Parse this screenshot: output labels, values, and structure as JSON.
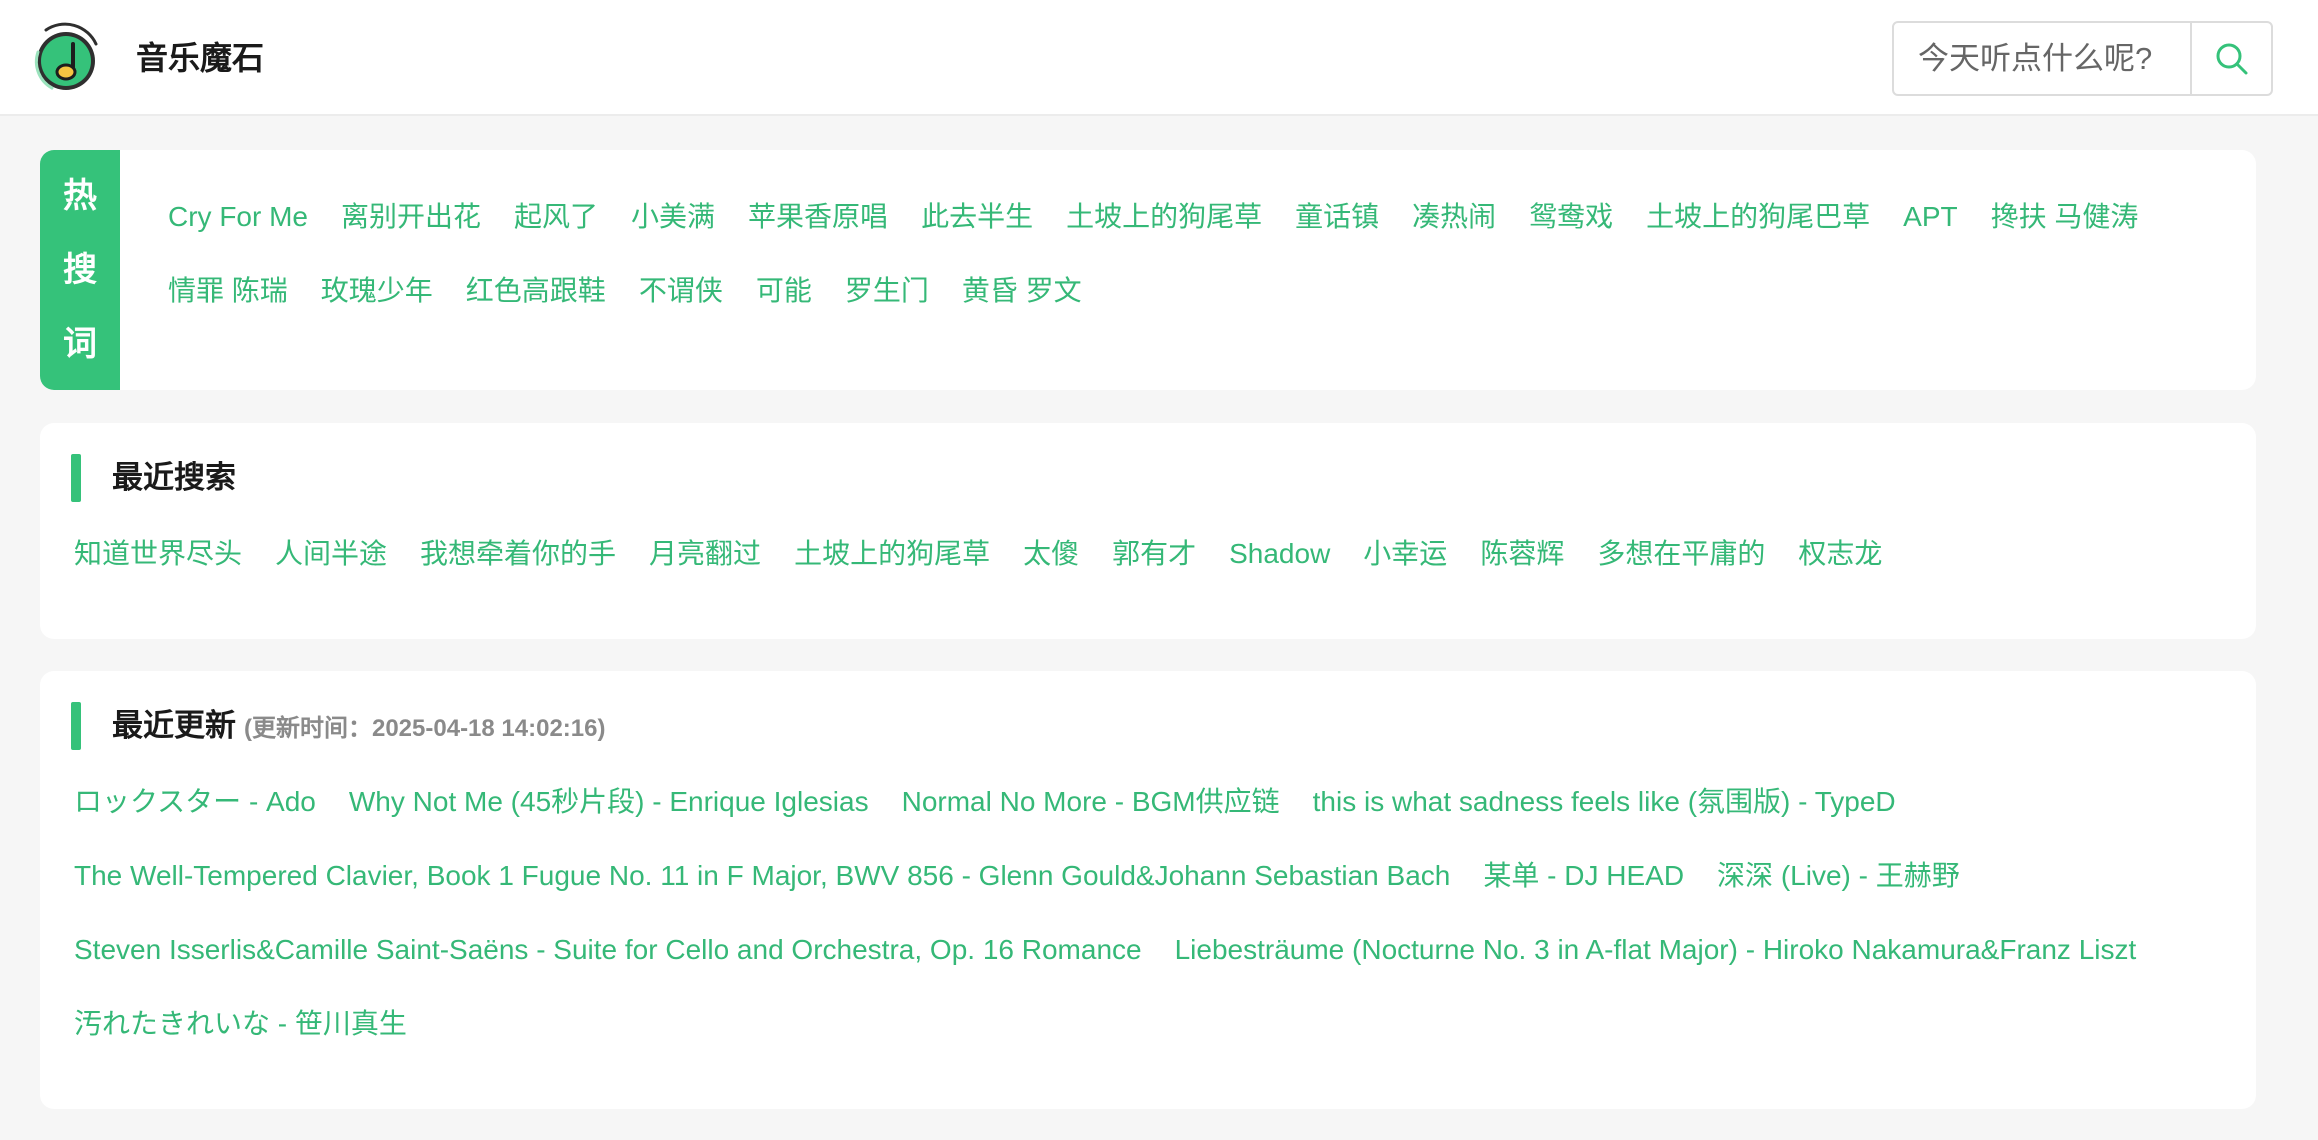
{
  "header": {
    "app_title": "音乐魔石",
    "search_placeholder": "今天听点什么呢?",
    "logo_icon": "music-note-logo-icon",
    "search_icon": "search-icon",
    "accent_color": "#35c27a"
  },
  "hot": {
    "label_chars": [
      "热",
      "搜",
      "词"
    ],
    "items": [
      "Cry For Me",
      "离别开出花",
      "起风了",
      "小美满",
      "苹果香原唱",
      "此去半生",
      "土坡上的狗尾草",
      "童话镇",
      "凑热闹",
      "鸳鸯戏",
      "土坡上的狗尾巴草",
      "APT",
      "搀扶 马健涛",
      "情罪 陈瑞",
      "玫瑰少年",
      "红色高跟鞋",
      "不谓侠",
      "可能",
      "罗生门",
      "黄昏 罗文"
    ]
  },
  "recent_search": {
    "title": "最近搜索",
    "items": [
      "知道世界尽头",
      "人间半途",
      "我想牵着你的手",
      "月亮翻过",
      "土坡上的狗尾草",
      "太傻",
      "郭有才",
      "Shadow",
      "小幸运",
      "陈蓉辉",
      "多想在平庸的",
      "权志龙"
    ]
  },
  "recent_update": {
    "title": "最近更新",
    "subtitle": "(更新时间：2025-04-18 14:02:16)",
    "items": [
      "ロックスター - Ado",
      "Why Not Me (45秒片段) - Enrique Iglesias",
      "Normal No More - BGM供应链",
      "this is what sadness feels like (氛围版) - TypeD",
      "The Well-Tempered Clavier, Book 1 Fugue No. 11 in F Major, BWV 856 - Glenn Gould&Johann Sebastian Bach",
      "某单 - DJ HEAD",
      "深深 (Live) - 王赫野",
      "Steven Isserlis&Camille Saint-Saëns - Suite for Cello and Orchestra, Op. 16 Romance",
      "Liebesträume (Nocturne No. 3 in A-flat Major) - Hiroko Nakamura&Franz Liszt",
      "汚れたきれいな - 笹川真生"
    ]
  }
}
